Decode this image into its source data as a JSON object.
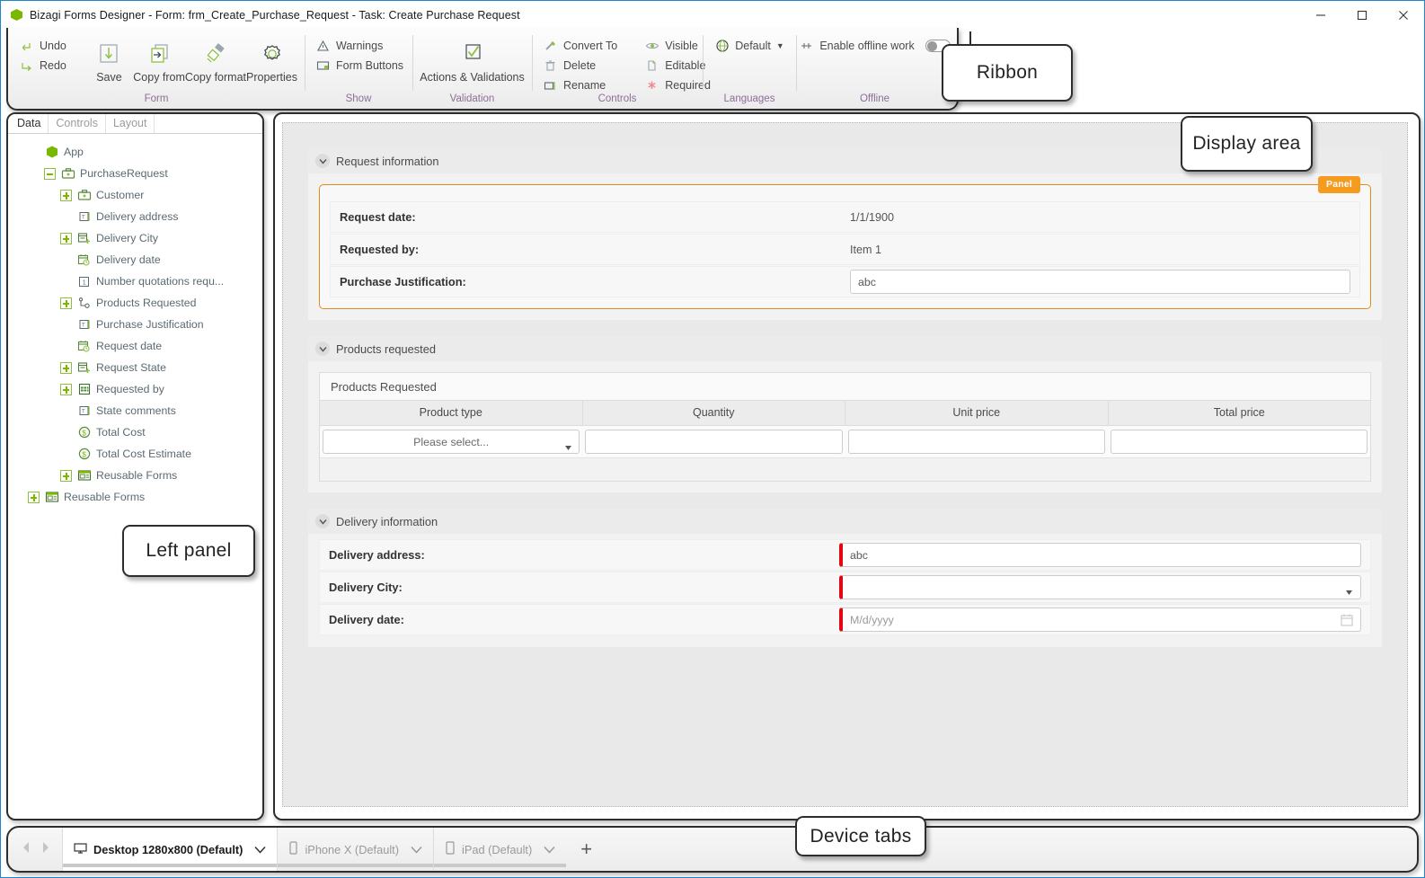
{
  "window": {
    "title": "Bizagi Forms Designer  - Form: frm_Create_Purchase_Request - Task:  Create Purchase Request",
    "logo_icon": "bizagi-hex-logo",
    "minimize_icon": "minimize-icon",
    "maximize_icon": "maximize-icon",
    "close_icon": "close-icon",
    "accent": "#1e86d0"
  },
  "ribbon": {
    "groups": [
      {
        "label": "Form",
        "small_items": [
          {
            "label": "Undo",
            "icon": "undo-icon"
          },
          {
            "label": "Redo",
            "icon": "redo-icon"
          }
        ],
        "big_items": [
          {
            "label": "Save",
            "icon": "save-icon"
          },
          {
            "label": "Copy from",
            "icon": "copy-from-icon"
          },
          {
            "label": "Copy format",
            "icon": "copy-format-icon"
          },
          {
            "label": "Properties",
            "icon": "properties-gear-icon"
          }
        ]
      },
      {
        "label": "Show",
        "small_items": [
          {
            "label": "Warnings",
            "icon": "warning-triangle-icon"
          },
          {
            "label": "Form Buttons",
            "icon": "form-buttons-icon"
          }
        ]
      },
      {
        "label": "Validation",
        "big_items": [
          {
            "label": "Actions & Validations",
            "icon": "checkbox-check-icon"
          }
        ]
      },
      {
        "label": "Controls",
        "small_items": [
          {
            "label": "Convert To",
            "icon": "convert-to-icon"
          },
          {
            "label": "Delete",
            "icon": "trash-icon"
          },
          {
            "label": "Rename",
            "icon": "rename-icon"
          }
        ],
        "small_items_2": [
          {
            "label": "Visible",
            "icon": "eye-icon"
          },
          {
            "label": "Editable",
            "icon": "editable-page-icon"
          },
          {
            "label": "Required",
            "icon": "required-asterisk-icon"
          }
        ]
      },
      {
        "label": "Languages",
        "items": [
          {
            "label": "Default",
            "icon": "globe-icon",
            "has_dropdown": true
          }
        ]
      },
      {
        "label": "Offline",
        "items": [
          {
            "label": "Enable offline work",
            "icon": "offline-icon",
            "toggle": "off"
          }
        ]
      }
    ]
  },
  "left_panel": {
    "tabs": [
      {
        "label": "Data",
        "active": true
      },
      {
        "label": "Controls",
        "active": false
      },
      {
        "label": "Layout",
        "active": false
      }
    ],
    "tree": [
      {
        "label": "App",
        "indent": 0,
        "expander": "none",
        "icon": "app-hex-icon"
      },
      {
        "label": "PurchaseRequest",
        "indent": 1,
        "expander": "minus",
        "icon": "entity-briefcase-icon"
      },
      {
        "label": "Customer",
        "indent": 2,
        "expander": "plus",
        "icon": "entity-briefcase-icon"
      },
      {
        "label": "Delivery address",
        "indent": 2,
        "expander": "none",
        "icon": "text-field-icon"
      },
      {
        "label": "Delivery City",
        "indent": 2,
        "expander": "plus",
        "icon": "list-entity-icon"
      },
      {
        "label": "Delivery date",
        "indent": 2,
        "expander": "none",
        "icon": "date-icon"
      },
      {
        "label": "Number quotations requ...",
        "indent": 2,
        "expander": "none",
        "icon": "number-icon"
      },
      {
        "label": "Products Requested",
        "indent": 2,
        "expander": "plus",
        "icon": "collection-icon"
      },
      {
        "label": "Purchase Justification",
        "indent": 2,
        "expander": "none",
        "icon": "text-field-icon"
      },
      {
        "label": "Request date",
        "indent": 2,
        "expander": "none",
        "icon": "date-icon"
      },
      {
        "label": "Request State",
        "indent": 2,
        "expander": "plus",
        "icon": "list-entity-icon"
      },
      {
        "label": "Requested by",
        "indent": 2,
        "expander": "plus",
        "icon": "table-entity-icon"
      },
      {
        "label": "State comments",
        "indent": 2,
        "expander": "none",
        "icon": "text-field-icon"
      },
      {
        "label": "Total Cost",
        "indent": 2,
        "expander": "none",
        "icon": "currency-icon"
      },
      {
        "label": "Total Cost Estimate",
        "indent": 2,
        "expander": "none",
        "icon": "currency-icon"
      },
      {
        "label": "Reusable Forms",
        "indent": 2,
        "expander": "plus",
        "icon": "reusable-forms-icon"
      },
      {
        "label": "Reusable Forms",
        "indent": 0,
        "expander": "plus",
        "icon": "reusable-forms-icon"
      }
    ]
  },
  "form": {
    "sections": [
      {
        "title": "Request information",
        "panel_tag": "Panel",
        "panel_tag_color": "#f59b20",
        "rows": [
          {
            "label": "Request date:",
            "value": "1/1/1900",
            "type": "text"
          },
          {
            "label": "Requested by:",
            "value": "Item 1",
            "type": "text"
          },
          {
            "label": "Purchase Justification:",
            "value": "abc",
            "type": "input"
          }
        ]
      },
      {
        "title": "Products requested",
        "table": {
          "title": "Products Requested",
          "columns": [
            "Product type",
            "Quantity",
            "Unit price",
            "Total price"
          ],
          "rows": [
            [
              {
                "value": "Please select...",
                "type": "select"
              },
              {
                "value": "",
                "type": "input"
              },
              {
                "value": "",
                "type": "input"
              },
              {
                "value": "",
                "type": "input"
              }
            ]
          ]
        }
      },
      {
        "title": "Delivery information",
        "rows": [
          {
            "label": "Delivery address:",
            "value": "abc",
            "type": "input",
            "required": true
          },
          {
            "label": "Delivery City:",
            "value": "",
            "type": "select",
            "required": true
          },
          {
            "label": "Delivery date:",
            "value": "",
            "placeholder": "M/d/yyyy",
            "type": "date",
            "required": true
          }
        ]
      }
    ],
    "required_marker_color": "#e30613"
  },
  "device_bar": {
    "prev_icon": "chevron-left-icon",
    "next_icon": "chevron-right-icon",
    "tabs": [
      {
        "label": "Desktop 1280x800 (Default)",
        "icon": "monitor-icon",
        "active": true
      },
      {
        "label": "iPhone X  (Default)",
        "icon": "phone-icon",
        "active": false
      },
      {
        "label": "iPad (Default)",
        "icon": "tablet-icon",
        "active": false
      }
    ],
    "add_label": "+"
  },
  "callouts": {
    "ribbon": "Ribbon",
    "display_area": "Display area",
    "left_panel": "Left panel",
    "device_tabs": "Device tabs"
  }
}
